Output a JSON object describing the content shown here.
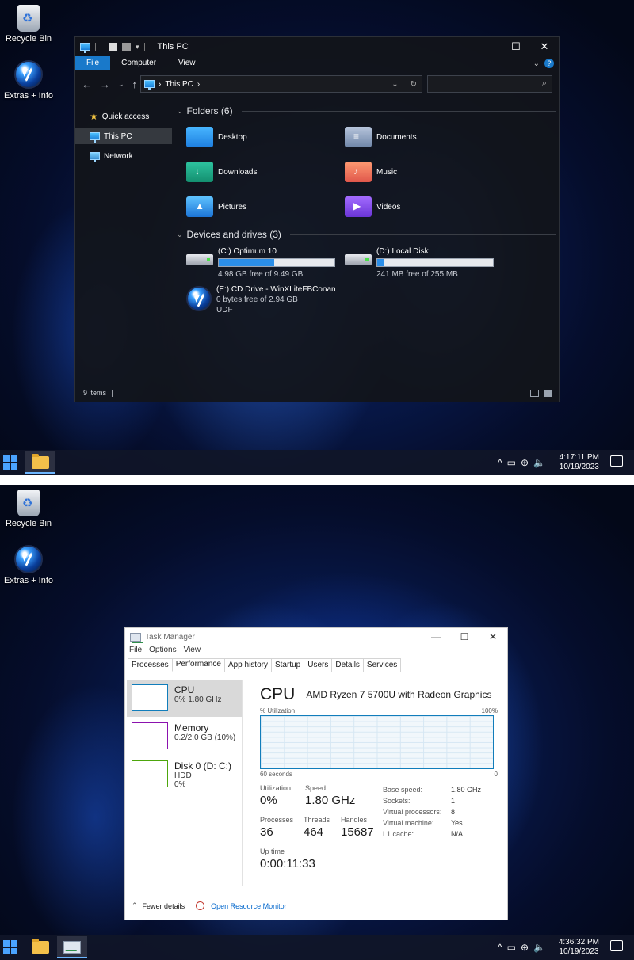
{
  "shot1": {
    "desktop_icons": [
      "Recycle Bin",
      "Extras + Info"
    ],
    "explorer": {
      "title": "This PC",
      "ribbon_tabs": [
        "File",
        "Computer",
        "View"
      ],
      "address": "This PC",
      "nav": [
        "Quick access",
        "This PC",
        "Network"
      ],
      "folders_heading": "Folders (6)",
      "folders": [
        "Desktop",
        "Documents",
        "Downloads",
        "Music",
        "Pictures",
        "Videos"
      ],
      "drives_heading": "Devices and drives (3)",
      "drives": [
        {
          "name": "(C:) Optimum 10",
          "free": "4.98 GB free of 9.49 GB",
          "used_fraction": 0.48
        },
        {
          "name": "(D:) Local Disk",
          "free": "241 MB free of 255 MB",
          "used_fraction": 0.06
        },
        {
          "name": "(E:) CD Drive - WinXLiteFBConan",
          "free": "0 bytes free of 2.94 GB",
          "fs": "UDF"
        }
      ],
      "status": "9 items"
    },
    "taskbar": {
      "time": "4:17:11 PM",
      "date": "10/19/2023"
    }
  },
  "shot2": {
    "desktop_icons": [
      "Recycle Bin",
      "Extras + Info"
    ],
    "taskmgr": {
      "title": "Task Manager",
      "menu": [
        "File",
        "Options",
        "View"
      ],
      "tabs": [
        "Processes",
        "Performance",
        "App history",
        "Startup",
        "Users",
        "Details",
        "Services"
      ],
      "resources": [
        {
          "name": "CPU",
          "detail": "0% 1.80 GHz",
          "detail2": ""
        },
        {
          "name": "Memory",
          "detail": "0.2/2.0 GB (10%)",
          "detail2": ""
        },
        {
          "name": "Disk 0 (D: C:)",
          "detail": "HDD",
          "detail2": "0%"
        }
      ],
      "heading": "CPU",
      "model": "AMD Ryzen 7 5700U with Radeon Graphics",
      "graph_label": "% Utilization",
      "graph_max": "100%",
      "graph_time": "60 seconds",
      "graph_min": "0",
      "utilization_label": "Utilization",
      "utilization": "0%",
      "speed_label": "Speed",
      "speed": "1.80 GHz",
      "processes_label": "Processes",
      "processes": "36",
      "threads_label": "Threads",
      "threads": "464",
      "handles_label": "Handles",
      "handles": "15687",
      "uptime_label": "Up time",
      "uptime": "0:00:11:33",
      "specs": [
        {
          "k": "Base speed:",
          "v": "1.80 GHz"
        },
        {
          "k": "Sockets:",
          "v": "1"
        },
        {
          "k": "Virtual processors:",
          "v": "8"
        },
        {
          "k": "Virtual machine:",
          "v": "Yes"
        },
        {
          "k": "L1 cache:",
          "v": "N/A"
        }
      ],
      "fewer_details": "Fewer details",
      "resource_monitor": "Open Resource Monitor"
    },
    "taskbar": {
      "time": "4:36:32 PM",
      "date": "10/19/2023"
    }
  }
}
